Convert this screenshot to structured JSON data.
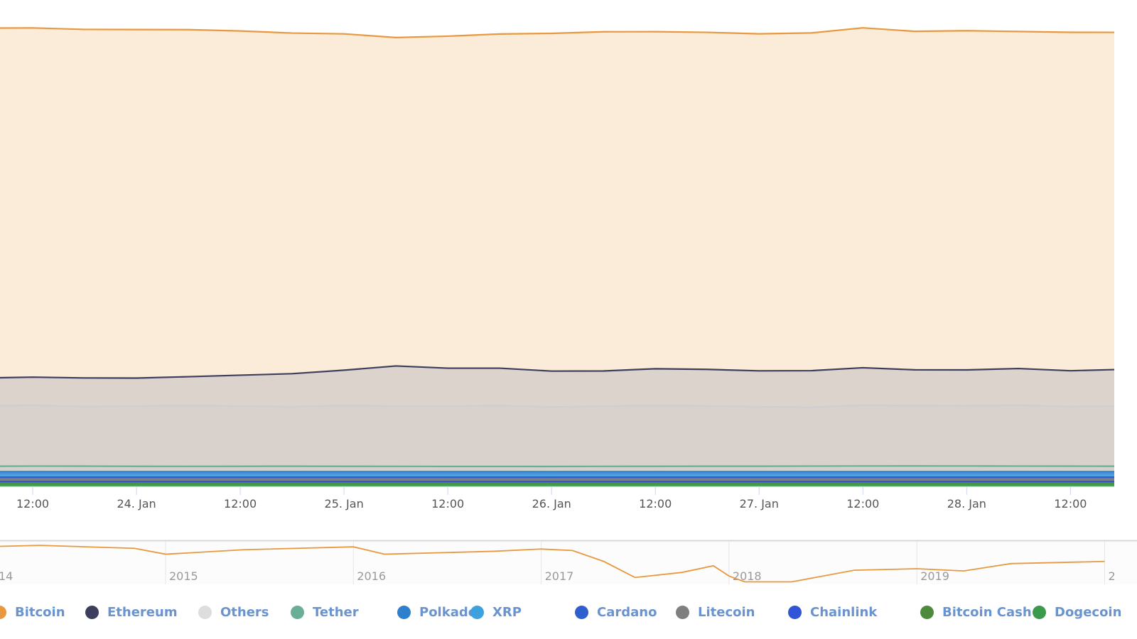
{
  "chart_data": {
    "type": "area",
    "stacking": "normal",
    "title": "",
    "xlabel": "",
    "ylabel": "",
    "grid": true,
    "legend_position": "bottom",
    "x_tick_labels": [
      "12:00",
      "24. Jan",
      "12:00",
      "25. Jan",
      "12:00",
      "26. Jan",
      "12:00",
      "27. Jan",
      "12:00",
      "28. Jan",
      "12:00"
    ],
    "x": [
      "23 Jan 06:00",
      "23 Jan 12:00",
      "23 Jan 18:00",
      "24 Jan 00:00",
      "24 Jan 06:00",
      "24 Jan 12:00",
      "24 Jan 18:00",
      "25 Jan 00:00",
      "25 Jan 06:00",
      "25 Jan 12:00",
      "25 Jan 18:00",
      "26 Jan 00:00",
      "26 Jan 06:00",
      "26 Jan 12:00",
      "26 Jan 18:00",
      "27 Jan 00:00",
      "27 Jan 06:00",
      "27 Jan 12:00",
      "27 Jan 18:00",
      "28 Jan 00:00",
      "28 Jan 06:00",
      "28 Jan 12:00",
      "28 Jan 18:00",
      "29 Jan 00:00"
    ],
    "series": [
      {
        "name": "Bitcoin",
        "color": "#e8983e",
        "fill": "#fbebd9",
        "values": [
          48.8,
          48.7,
          48.6,
          48.6,
          48.4,
          48.0,
          47.5,
          46.9,
          45.8,
          46.3,
          46.6,
          47.1,
          47.3,
          47.0,
          47.0,
          47.0,
          47.1,
          47.4,
          47.2,
          47.3,
          47.0,
          47.2,
          47.0,
          46.8
        ]
      },
      {
        "name": "Ethereum",
        "color": "#3d3d5e",
        "fill": "#dcd3cd",
        "values": [
          3.9,
          3.9,
          4.0,
          3.9,
          4.0,
          4.3,
          4.6,
          4.9,
          5.6,
          5.3,
          5.2,
          5.0,
          4.9,
          5.1,
          5.1,
          5.0,
          5.1,
          5.2,
          5.0,
          5.0,
          5.1,
          5.0,
          5.1,
          5.2
        ]
      },
      {
        "name": "Others",
        "color": "#cfcfcf",
        "fill": "#d9d1cb",
        "values": [
          8.4,
          8.5,
          8.3,
          8.4,
          8.5,
          8.4,
          8.3,
          8.5,
          8.4,
          8.4,
          8.5,
          8.3,
          8.4,
          8.5,
          8.4,
          8.3,
          8.2,
          8.5,
          8.4,
          8.4,
          8.5,
          8.3,
          8.4,
          8.4
        ]
      },
      {
        "name": "Tether",
        "color": "#6aae96",
        "fill": "#cfd3cc",
        "values": [
          0.75,
          0.78,
          0.77,
          0.75,
          0.74,
          0.75,
          0.76,
          0.75,
          0.74,
          0.73,
          0.73,
          0.72,
          0.74,
          0.75,
          0.76,
          0.76,
          0.78,
          0.79,
          0.8,
          0.79,
          0.78,
          0.77,
          0.76,
          0.77
        ]
      },
      {
        "name": "Polkadot",
        "color": "#2f7fcf",
        "fill": "#4f8fd6",
        "values": [
          0.4,
          0.4,
          0.4,
          0.4,
          0.4,
          0.4,
          0.4,
          0.4,
          0.4,
          0.4,
          0.4,
          0.4,
          0.4,
          0.4,
          0.4,
          0.4,
          0.4,
          0.4,
          0.4,
          0.4,
          0.4,
          0.4,
          0.4,
          0.4
        ]
      },
      {
        "name": "XRP",
        "color": "#3ea0dc",
        "fill": "#5aaee0",
        "values": [
          0.35,
          0.35,
          0.35,
          0.35,
          0.35,
          0.35,
          0.35,
          0.35,
          0.35,
          0.35,
          0.35,
          0.35,
          0.35,
          0.35,
          0.35,
          0.35,
          0.35,
          0.35,
          0.35,
          0.35,
          0.35,
          0.35,
          0.35,
          0.35
        ]
      },
      {
        "name": "Cardano",
        "color": "#2f5fcf",
        "fill": "#4a70d2",
        "values": [
          0.3,
          0.3,
          0.3,
          0.3,
          0.3,
          0.3,
          0.3,
          0.3,
          0.3,
          0.3,
          0.3,
          0.3,
          0.3,
          0.3,
          0.3,
          0.3,
          0.3,
          0.3,
          0.3,
          0.3,
          0.3,
          0.3,
          0.3,
          0.3
        ]
      },
      {
        "name": "Litecoin",
        "color": "#7f7f7f",
        "fill": "#8a8a8a",
        "values": [
          0.3,
          0.3,
          0.3,
          0.3,
          0.3,
          0.3,
          0.3,
          0.3,
          0.3,
          0.3,
          0.3,
          0.3,
          0.3,
          0.3,
          0.3,
          0.3,
          0.3,
          0.3,
          0.3,
          0.3,
          0.3,
          0.3,
          0.3,
          0.3
        ]
      },
      {
        "name": "Chainlink",
        "color": "#3155d6",
        "fill": "#4a68d8",
        "values": [
          0.2,
          0.2,
          0.2,
          0.2,
          0.2,
          0.2,
          0.2,
          0.2,
          0.2,
          0.2,
          0.2,
          0.2,
          0.2,
          0.2,
          0.2,
          0.2,
          0.2,
          0.2,
          0.2,
          0.2,
          0.2,
          0.2,
          0.2,
          0.2
        ]
      },
      {
        "name": "Bitcoin Cash",
        "color": "#4b8b3b",
        "fill": "#5e9a4e",
        "values": [
          0.25,
          0.25,
          0.25,
          0.25,
          0.25,
          0.25,
          0.25,
          0.25,
          0.25,
          0.25,
          0.25,
          0.25,
          0.25,
          0.25,
          0.25,
          0.25,
          0.25,
          0.25,
          0.25,
          0.25,
          0.25,
          0.25,
          0.25,
          0.25
        ]
      },
      {
        "name": "Dogecoin",
        "color": "#3c9a4c",
        "fill": "#52a85f",
        "values": [
          0.25,
          0.25,
          0.25,
          0.25,
          0.25,
          0.25,
          0.25,
          0.25,
          0.25,
          0.25,
          0.25,
          0.25,
          0.25,
          0.25,
          0.25,
          0.25,
          0.25,
          0.25,
          0.25,
          0.25,
          0.25,
          0.25,
          0.25,
          0.25
        ]
      }
    ],
    "navigator": {
      "x_tick_labels": [
        "14",
        "2015",
        "2016",
        "2017",
        "2018",
        "2019",
        "2"
      ],
      "series_name": "Bitcoin",
      "color": "#e8983e",
      "x": [
        "2014-01",
        "2014-05",
        "2014-11",
        "2015-01",
        "2015-06",
        "2016-01",
        "2016-03",
        "2016-10",
        "2017-01",
        "2017-03",
        "2017-05",
        "2017-07",
        "2017-10",
        "2017-12",
        "2018-01",
        "2018-02",
        "2018-05",
        "2018-09",
        "2019-01",
        "2019-04",
        "2019-07",
        "2020-01"
      ],
      "values": [
        92.5,
        95,
        90,
        80,
        87.6,
        92.5,
        80,
        85,
        88.8,
        86.3,
        67.7,
        40.4,
        49.1,
        60.3,
        42.9,
        33,
        33,
        52.8,
        55.3,
        51.6,
        64,
        67.7
      ]
    }
  }
}
